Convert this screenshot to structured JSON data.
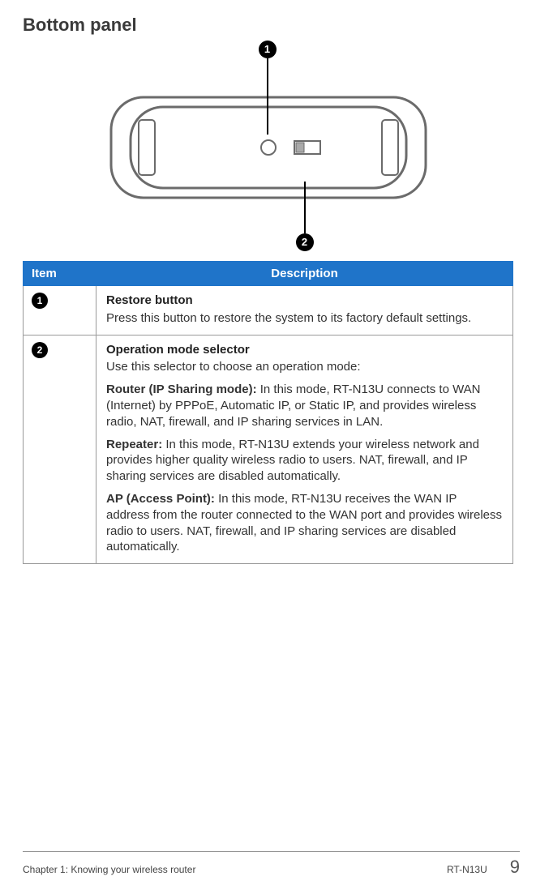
{
  "title": "Bottom panel",
  "callouts": {
    "c1": "1",
    "c2": "2"
  },
  "table": {
    "headers": {
      "item": "Item",
      "desc": "Description"
    },
    "rows": [
      {
        "num": "1",
        "title": "Restore button",
        "intro": "Press this button to restore the system to its factory default settings."
      },
      {
        "num": "2",
        "title": "Operation mode selector",
        "intro": "Use this selector to choose an operation mode:",
        "modes": [
          {
            "label": "Router (IP Sharing mode):",
            "text": " In this mode, RT-N13U connects to WAN (Internet) by PPPoE, Automatic IP, or Static IP, and provides wireless radio, NAT, firewall, and IP sharing services in LAN."
          },
          {
            "label": "Repeater:",
            "text": " In this mode, RT-N13U extends your wireless network and provides higher quality wireless radio to users. NAT, firewall, and IP sharing services are disabled automatically."
          },
          {
            "label": "AP (Access Point):",
            "text": " In this mode, RT-N13U receives the WAN IP address from the router connected to the WAN port and provides wireless radio to users. NAT, firewall, and IP sharing services are disabled automatically."
          }
        ]
      }
    ]
  },
  "footer": {
    "left": "Chapter 1: Knowing your wireless router",
    "mid": "RT-N13U",
    "page": "9"
  }
}
